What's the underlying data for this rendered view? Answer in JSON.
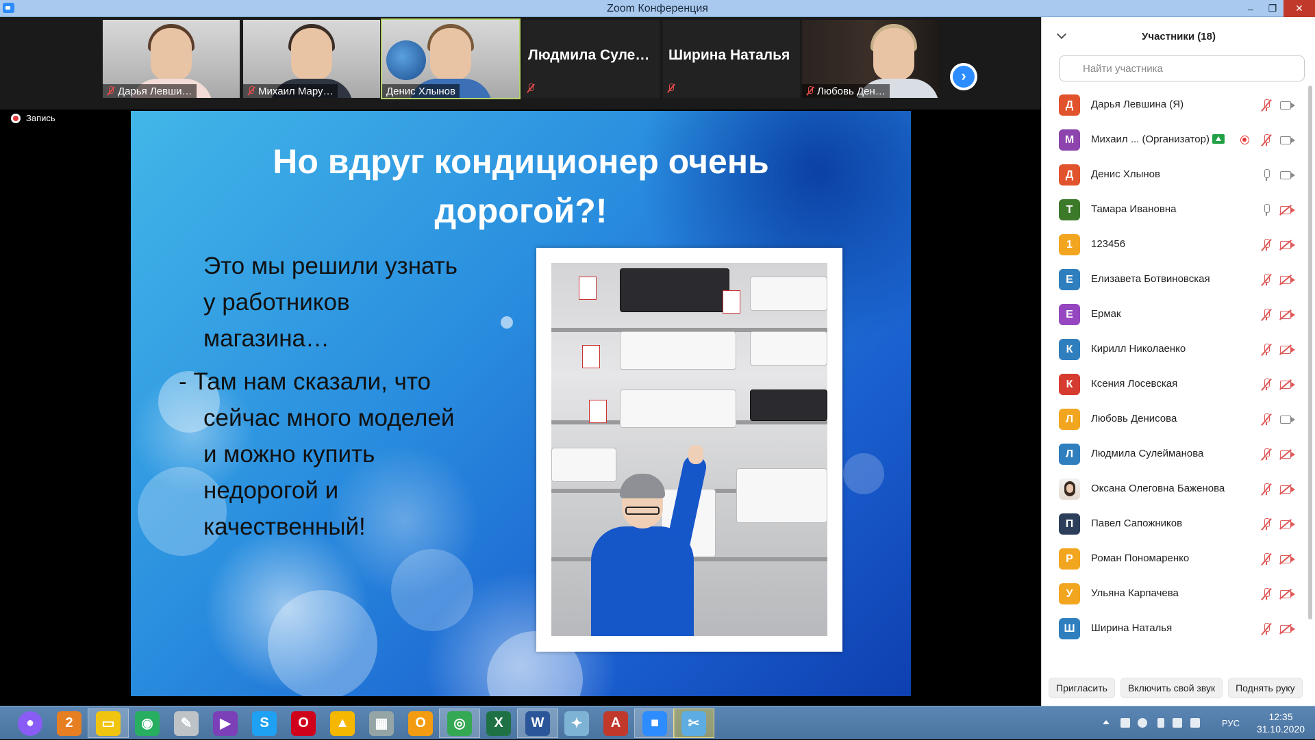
{
  "window": {
    "title": "Zoom Конференция"
  },
  "thumbnails": [
    {
      "name": "Дарья Левши…",
      "video": true
    },
    {
      "name": "Михаил Мару…",
      "video": true
    },
    {
      "name": "Денис Хлынов",
      "video": true,
      "active": true
    },
    {
      "name": "Людмила  Суле…",
      "video": false
    },
    {
      "name": "Ширина Наталья",
      "video": false
    },
    {
      "name": "Любовь Ден…",
      "video": true
    }
  ],
  "recording": {
    "label": "Запись"
  },
  "slide": {
    "title_line1": "Но вдруг кондиционер очень",
    "title_line2": "дорогой?!",
    "para1_line1": "Это мы решили узнать",
    "para1_line2": "у работников",
    "para1_line3": "магазина…",
    "para2_line1": "- Там нам сказали, что",
    "para2_line2": "сейчас много моделей",
    "para2_line3": "и можно купить",
    "para2_line4": "недорогой и",
    "para2_line5": "качественный!"
  },
  "panel": {
    "title": "Участники (18)",
    "search_placeholder": "Найти участника",
    "participants": [
      {
        "initial": "Д",
        "name": "Дарья Левшина (Я)",
        "color": "#e0532d",
        "mic": "muted",
        "cam": "on"
      },
      {
        "initial": "М",
        "name": "Михаил ...  (Организатор)",
        "color": "#8e44ad",
        "mic": "muted",
        "cam": "on",
        "host": true,
        "recording": true
      },
      {
        "initial": "Д",
        "name": "Денис Хлынов",
        "color": "#e0532d",
        "mic": "on",
        "cam": "on"
      },
      {
        "initial": "Т",
        "name": "Тамара Ивановна",
        "color": "#3c7a2a",
        "mic": "on",
        "cam": "off"
      },
      {
        "initial": "1",
        "name": "123456",
        "color": "#f2a51f",
        "mic": "muted",
        "cam": "off"
      },
      {
        "initial": "Е",
        "name": "Елизавета Ботвиновская",
        "color": "#2f7fbf",
        "mic": "muted",
        "cam": "off"
      },
      {
        "initial": "Е",
        "name": "Ермак",
        "color": "#9646c0",
        "mic": "muted",
        "cam": "off"
      },
      {
        "initial": "К",
        "name": "Кирилл Николаенко",
        "color": "#2f7fbf",
        "mic": "muted",
        "cam": "off"
      },
      {
        "initial": "К",
        "name": "Ксения Лосевская",
        "color": "#d63b2f",
        "mic": "muted",
        "cam": "off"
      },
      {
        "initial": "Л",
        "name": "Любовь Денисова",
        "color": "#f2a51f",
        "mic": "muted",
        "cam": "on"
      },
      {
        "initial": "Л",
        "name": "Людмила Сулейманова",
        "color": "#2f7fbf",
        "mic": "muted",
        "cam": "off"
      },
      {
        "initial": "",
        "name": "Оксана Олеговна Баженова",
        "color": "photo",
        "mic": "muted",
        "cam": "off"
      },
      {
        "initial": "П",
        "name": "Павел Сапожников",
        "color": "#2c3e5a",
        "mic": "muted",
        "cam": "off"
      },
      {
        "initial": "Р",
        "name": "Роман Пономаренко",
        "color": "#f2a51f",
        "mic": "muted",
        "cam": "off"
      },
      {
        "initial": "У",
        "name": "Ульяна Карпачева",
        "color": "#f2a51f",
        "mic": "muted",
        "cam": "off"
      },
      {
        "initial": "Ш",
        "name": "Ширина Наталья",
        "color": "#2f7fbf",
        "mic": "muted",
        "cam": "off"
      }
    ],
    "footer": {
      "invite": "Пригласить",
      "unmute": "Включить свой звук",
      "raise_hand": "Поднять руку"
    }
  },
  "taskbar": {
    "apps": [
      {
        "icon": "assistant-icon",
        "color": "#8a5cf6",
        "glyph": "●"
      },
      {
        "icon": "maps-icon",
        "color": "#e67e22",
        "glyph": "2"
      },
      {
        "icon": "folder-icon",
        "color": "#f1c40f",
        "glyph": "▭",
        "active": true
      },
      {
        "icon": "browser-icon",
        "color": "#27ae60",
        "glyph": "◉"
      },
      {
        "icon": "notes-icon",
        "color": "#bdc3c7",
        "glyph": "✎"
      },
      {
        "icon": "visual-studio-icon",
        "color": "#7b3fb8",
        "glyph": "▶"
      },
      {
        "icon": "skype-icon",
        "color": "#1ea1f2",
        "glyph": "S"
      },
      {
        "icon": "opera-icon",
        "color": "#d0021b",
        "glyph": "O"
      },
      {
        "icon": "arcade-icon",
        "color": "#f5b700",
        "glyph": "▲"
      },
      {
        "icon": "calculator-icon",
        "color": "#95a5a6",
        "glyph": "▦"
      },
      {
        "icon": "outlook-icon",
        "color": "#f39c12",
        "glyph": "O"
      },
      {
        "icon": "chrome-icon",
        "color": "#34a853",
        "glyph": "◎",
        "active": true
      },
      {
        "icon": "excel-icon",
        "color": "#1e7145",
        "glyph": "X"
      },
      {
        "icon": "word-icon",
        "color": "#2b579a",
        "glyph": "W",
        "active": true
      },
      {
        "icon": "paint-icon",
        "color": "#7fb3d5",
        "glyph": "✦"
      },
      {
        "icon": "acrobat-icon",
        "color": "#c0392b",
        "glyph": "A"
      },
      {
        "icon": "zoom-icon",
        "color": "#2d8cff",
        "glyph": "■",
        "active": true
      },
      {
        "icon": "snipping-icon",
        "color": "#5dade2",
        "glyph": "✂",
        "active2": true
      }
    ],
    "language": "РУС",
    "time": "12:35",
    "date": "31.10.2020"
  }
}
